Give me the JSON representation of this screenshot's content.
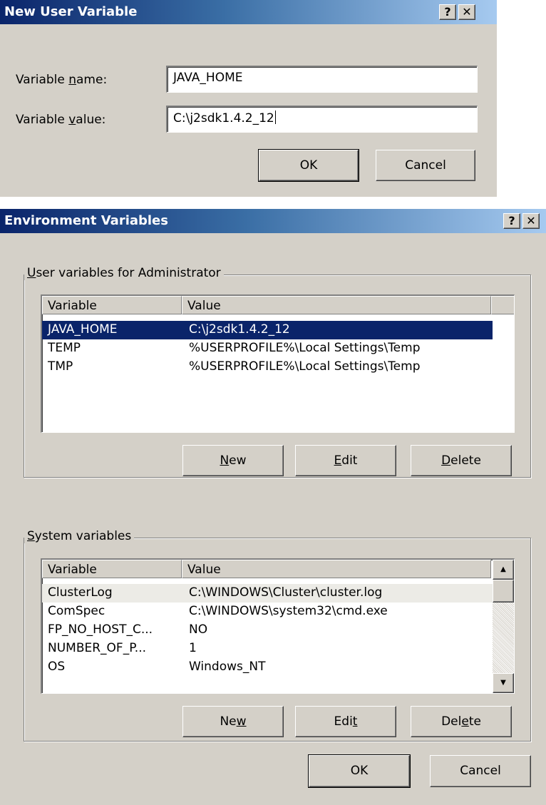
{
  "new_var_dialog": {
    "title": "New User Variable",
    "help_label": "?",
    "close_label": "✕",
    "name_label_pre": "Variable ",
    "name_label_key": "n",
    "name_label_post": "ame:",
    "name_value": "JAVA_HOME",
    "value_label_pre": "Variable ",
    "value_label_key": "v",
    "value_label_post": "alue:",
    "value_value": "C:\\j2sdk1.4.2_12",
    "ok_label": "OK",
    "cancel_label": "Cancel"
  },
  "env_dialog": {
    "title": "Environment Variables",
    "help_label": "?",
    "close_label": "✕",
    "user_group": {
      "legend_key": "U",
      "legend_rest": "ser variables for Administrator",
      "columns": [
        "Variable",
        "Value"
      ],
      "rows": [
        {
          "variable": "JAVA_HOME",
          "value": "C:\\j2sdk1.4.2_12",
          "selected": true
        },
        {
          "variable": "TEMP",
          "value": "%USERPROFILE%\\Local Settings\\Temp",
          "selected": false
        },
        {
          "variable": "TMP",
          "value": "%USERPROFILE%\\Local Settings\\Temp",
          "selected": false
        }
      ],
      "new_key": "N",
      "new_rest": "ew",
      "edit_key": "E",
      "edit_rest": "dit",
      "delete_key": "D",
      "delete_rest": "elete"
    },
    "system_group": {
      "legend_key": "S",
      "legend_rest": "ystem variables",
      "columns": [
        "Variable",
        "Value"
      ],
      "rows": [
        {
          "variable": "ClusterLog",
          "value": "C:\\WINDOWS\\Cluster\\cluster.log"
        },
        {
          "variable": "ComSpec",
          "value": "C:\\WINDOWS\\system32\\cmd.exe"
        },
        {
          "variable": "FP_NO_HOST_C...",
          "value": "NO"
        },
        {
          "variable": "NUMBER_OF_P...",
          "value": "1"
        },
        {
          "variable": "OS",
          "value": "Windows_NT"
        }
      ],
      "new_pre": "Ne",
      "new_key": "w",
      "new_post": "",
      "edit_pre": "Edi",
      "edit_key": "t",
      "edit_post": "",
      "delete_pre": "Del",
      "delete_key": "e",
      "delete_post": "te"
    },
    "ok_label": "OK",
    "cancel_label": "Cancel"
  },
  "colors": {
    "face": "#d4d0c8",
    "title_start": "#0a246a",
    "title_end": "#a6caf0",
    "selection": "#0a246a"
  }
}
